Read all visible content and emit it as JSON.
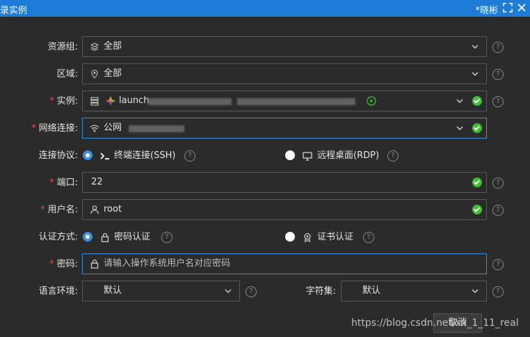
{
  "window": {
    "title": "录实例",
    "user": "*晓彬"
  },
  "form": {
    "resource_group": {
      "label": "资源组:",
      "value": "全部"
    },
    "region": {
      "label": "区域:",
      "value": "全部"
    },
    "instance": {
      "label": "实例:",
      "value": "launch"
    },
    "network": {
      "label": "网络连接:",
      "value": "公网"
    },
    "protocol": {
      "label": "连接协议:",
      "options": [
        "终端连接(SSH)",
        "远程桌面(RDP)"
      ],
      "selected": "终端连接(SSH)"
    },
    "port": {
      "label": "端口:",
      "value": "22"
    },
    "username": {
      "label": "用户名:",
      "value": "root"
    },
    "auth": {
      "label": "认证方式:",
      "options": [
        "密码认证",
        "证书认证"
      ],
      "selected": "密码认证"
    },
    "password": {
      "label": "密码:",
      "placeholder": "请输入操作系统用户名对应密码"
    },
    "locale": {
      "label": "语言环境:",
      "value": "默认"
    },
    "charset": {
      "label": "字符集:",
      "value": "默认"
    }
  },
  "buttons": {
    "cancel": "取消"
  },
  "watermark": "https://blog.csdn.net/xx_1_11_real",
  "colors": {
    "accent": "#1e7bd6",
    "ok": "#3dbe33",
    "required": "#e34d4d"
  }
}
